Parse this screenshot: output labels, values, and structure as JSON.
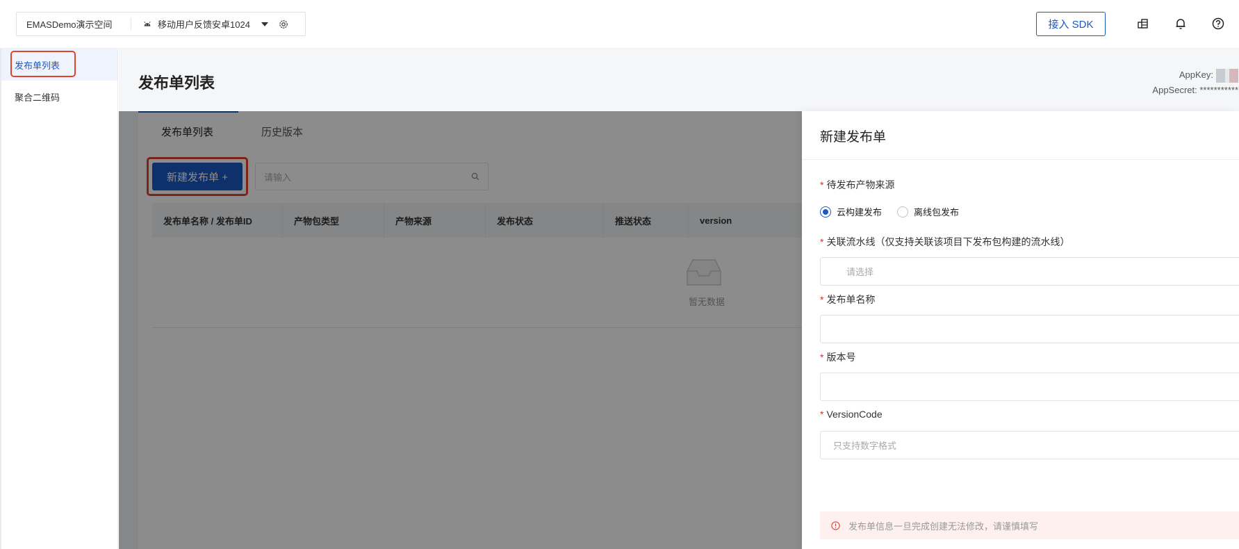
{
  "topbar": {
    "workspace": "EMASDemo演示空间",
    "app_name": "移动用户反馈安卓1024",
    "sdk_button": "接入 SDK",
    "icons": [
      "android-icon",
      "caret-down-icon",
      "gear-icon",
      "coins-icon",
      "bell-icon",
      "help-icon"
    ]
  },
  "sidebar": {
    "items": [
      {
        "label": "发布单列表",
        "active": true
      },
      {
        "label": "聚合二维码",
        "active": false
      }
    ]
  },
  "page": {
    "title": "发布单列表",
    "appkey_label": "AppKey:",
    "appsecret_label": "AppSecret: ***********"
  },
  "tabs": [
    {
      "label": "发布单列表",
      "active": true
    },
    {
      "label": "历史版本",
      "active": false
    }
  ],
  "toolbar": {
    "new_button": "新建发布单 +",
    "search_placeholder": "请输入"
  },
  "table": {
    "columns": [
      "发布单名称 / 发布单ID",
      "产物包类型",
      "产物来源",
      "发布状态",
      "推送状态",
      "version"
    ],
    "empty_text": "暂无数据"
  },
  "drawer": {
    "title": "新建发布单",
    "source_label": "待发布产物来源",
    "source_options": [
      {
        "label": "云构建发布",
        "checked": true
      },
      {
        "label": "离线包发布",
        "checked": false
      }
    ],
    "pipeline_label": "关联流水线（仅支持关联该项目下发布包构建的流水线）",
    "pipeline_placeholder": "请选择",
    "name_label": "发布单名称",
    "version_label": "版本号",
    "version_code_label": "VersionCode",
    "version_code_placeholder": "只支持数字格式",
    "alert_text": "发布单信息一旦完成创建无法修改，请谨慎填写"
  },
  "colors": {
    "primary": "#1b58c4",
    "highlight": "#e0432c",
    "required": "#d93026"
  }
}
